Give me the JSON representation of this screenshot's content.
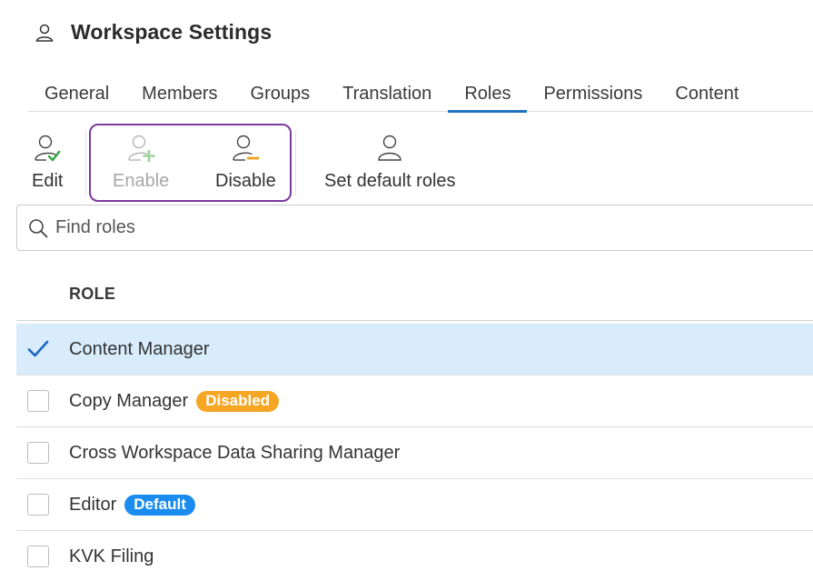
{
  "header": {
    "title": "Workspace Settings",
    "icon": "user-icon"
  },
  "tabs": [
    {
      "label": "General"
    },
    {
      "label": "Members"
    },
    {
      "label": "Groups"
    },
    {
      "label": "Translation"
    },
    {
      "label": "Roles",
      "active": true
    },
    {
      "label": "Permissions"
    },
    {
      "label": "Content"
    }
  ],
  "toolbar": {
    "edit_label": "Edit",
    "enable_label": "Enable",
    "disable_label": "Disable",
    "set_default_label": "Set default roles"
  },
  "search": {
    "placeholder": "Find roles"
  },
  "table": {
    "column_header": "ROLE",
    "rows": [
      {
        "name": "Content Manager",
        "selected": true,
        "badge": ""
      },
      {
        "name": "Copy Manager",
        "selected": false,
        "badge": "Disabled"
      },
      {
        "name": "Cross Workspace Data Sharing Manager",
        "selected": false,
        "badge": ""
      },
      {
        "name": "Editor",
        "selected": false,
        "badge": "Default"
      },
      {
        "name": "KVK Filing",
        "selected": false,
        "badge": ""
      }
    ]
  },
  "colors": {
    "accent": "#1f73c4",
    "highlight": "#7b3a9e",
    "disabled_badge": "#f5a623",
    "default_badge": "#1a8cf0",
    "selected_row": "#d8ecfb",
    "check_green": "#3aa64a"
  }
}
